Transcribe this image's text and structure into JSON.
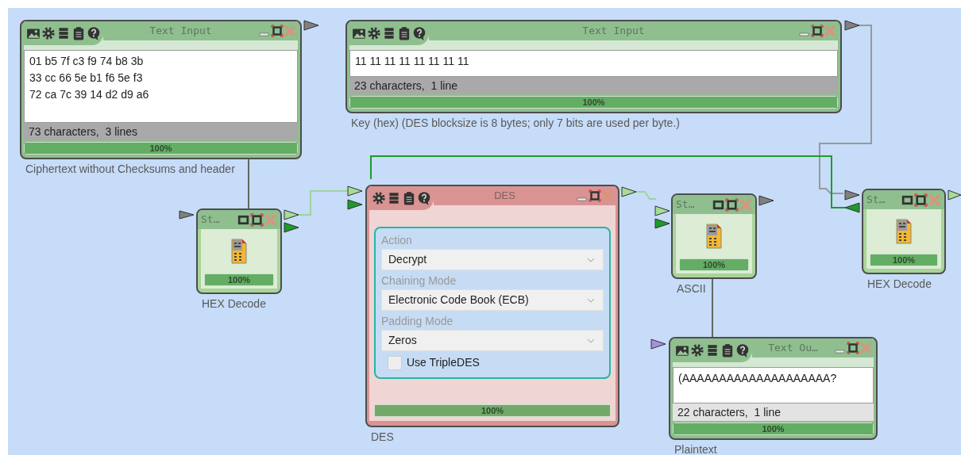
{
  "nodes": [
    {
      "kind": "text_input",
      "title": "Text Input",
      "lines": [
        "01 b5 7f c3 f9 74 b8 3b",
        "33 cc 66 5e b1 f6 5e f3",
        "72 ca 7c 39 14 d2 d9 a6"
      ],
      "status": "73 characters,  3 lines",
      "progress_label": "100%",
      "level": 1,
      "caption": "Ciphertext without Checksums and header"
    },
    {
      "kind": "text_input",
      "title": "Text Input",
      "lines": [
        "11 11 11 11 11 11 11 11"
      ],
      "status": "23 characters,  1 line",
      "progress_label": "100%",
      "level": 1,
      "caption": "Key (hex) (DES blocksize is 8 bytes; only 7 bits are used per byte.)"
    },
    {
      "kind": "converter",
      "title": "St…",
      "progress_label": "100%",
      "level": 1,
      "caption": "HEX Decode"
    },
    {
      "kind": "des",
      "title": "DES",
      "fields": [
        {
          "label": "Action",
          "value": "Decrypt"
        },
        {
          "label": "Chaining Mode",
          "value": "Electronic Code Book (ECB)"
        },
        {
          "label": "Padding Mode",
          "value": "Zeros"
        }
      ],
      "checkbox": {
        "label": "Use TripleDES",
        "checked": false
      },
      "progress_label": "100%",
      "level": 1,
      "caption": "DES"
    },
    {
      "kind": "converter",
      "title": "St…",
      "progress_label": "100%",
      "level": 1,
      "caption": "ASCII"
    },
    {
      "kind": "converter",
      "title": "St…",
      "progress_label": "100%",
      "level": 1,
      "caption": "HEX Decode"
    },
    {
      "kind": "text_output",
      "title": "Text Ou…",
      "lines": [
        "(AAAAAAAAAAAAAAAAAAAA?"
      ],
      "status": "22 characters,  1 line",
      "progress_label": "100%",
      "level": 1,
      "caption": "Plaintext"
    }
  ]
}
